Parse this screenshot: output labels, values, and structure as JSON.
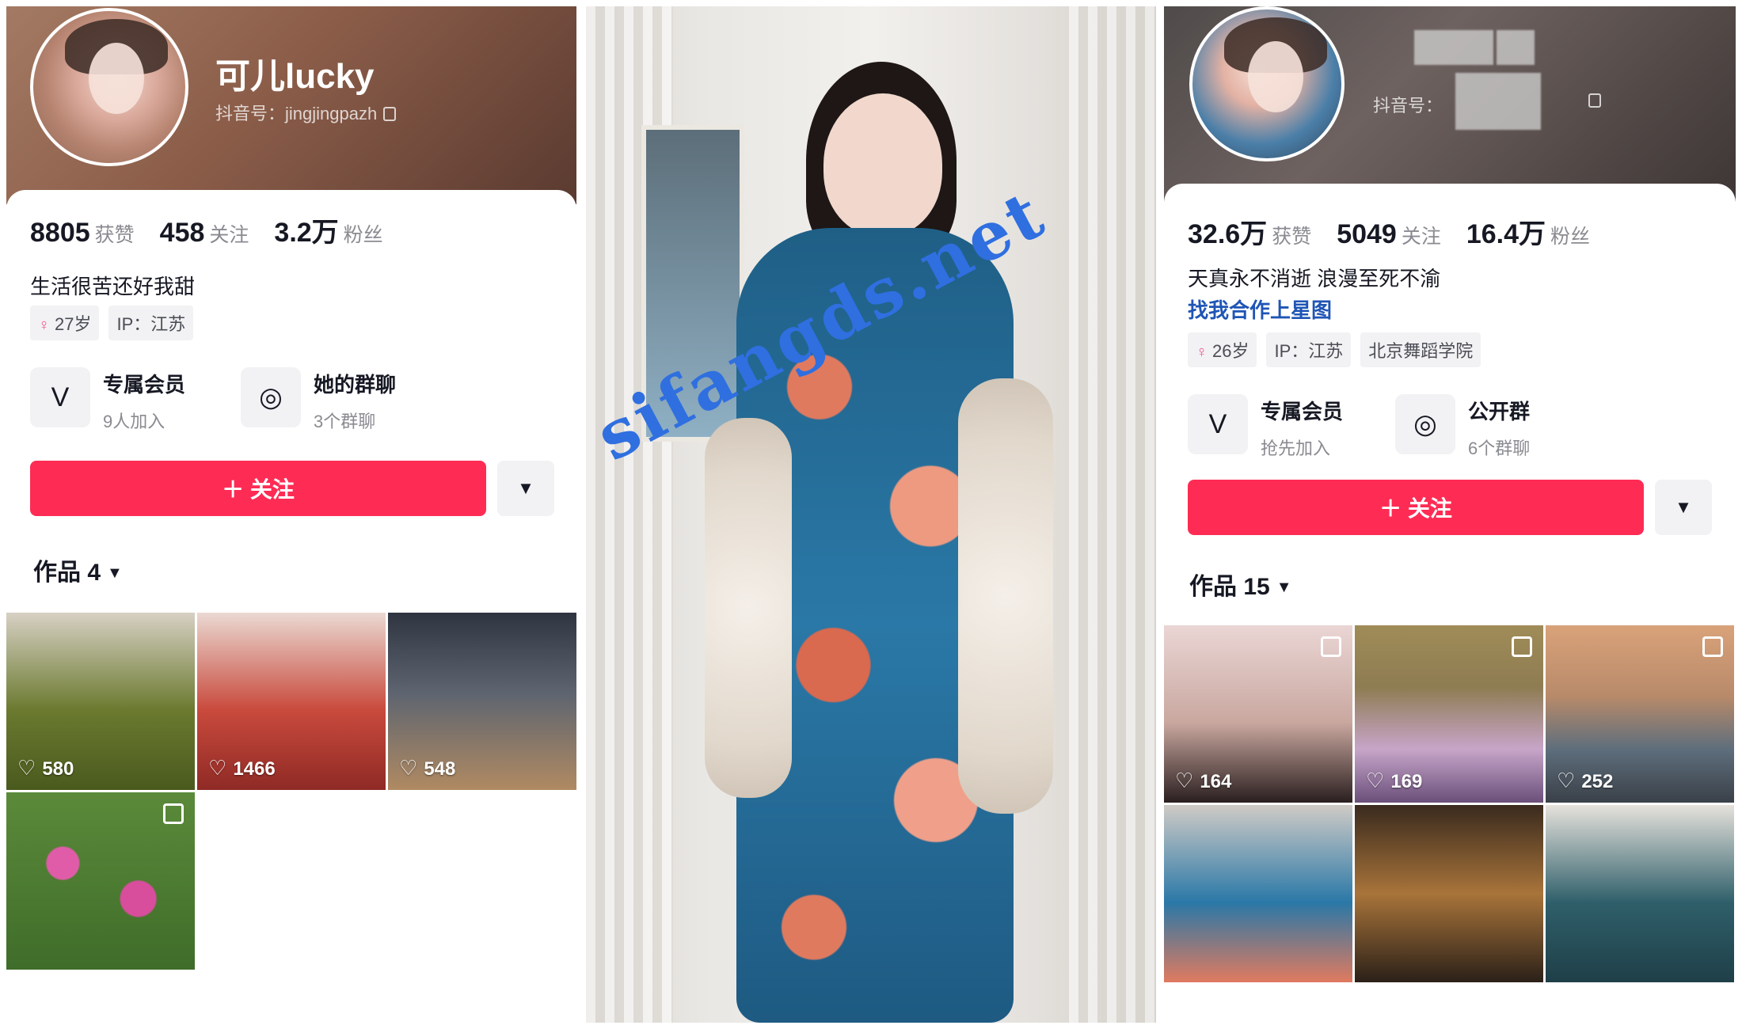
{
  "left": {
    "nickname": "可儿lucky",
    "douyin_id": "抖音号：jingjingpazh",
    "stats": [
      {
        "num": "8805",
        "label": "获赞"
      },
      {
        "num": "458",
        "label": "关注"
      },
      {
        "num": "3.2万",
        "label": "粉丝"
      }
    ],
    "bio": "生活很苦还好我甜",
    "tags": {
      "age": "27岁",
      "ip": "IP：江苏"
    },
    "features": [
      {
        "title": "专属会员",
        "sub": "9人加入"
      },
      {
        "title": "她的群聊",
        "sub": "3个群聊"
      }
    ],
    "follow_label": "＋ 关注",
    "works_label": "作品 4",
    "thumbs": [
      {
        "likes": "580"
      },
      {
        "likes": "1466"
      },
      {
        "likes": "548"
      },
      {
        "likes": ""
      }
    ]
  },
  "middle": {
    "watermark": "sifangds.net"
  },
  "right": {
    "douyin_id": "抖音号：",
    "stats": [
      {
        "num": "32.6万",
        "label": "获赞"
      },
      {
        "num": "5049",
        "label": "关注"
      },
      {
        "num": "16.4万",
        "label": "粉丝"
      }
    ],
    "bio": "天真永不消逝 浪漫至死不渝",
    "bio_link": "找我合作上星图",
    "tags": {
      "age": "26岁",
      "ip": "IP：江苏",
      "school": "北京舞蹈学院"
    },
    "features": [
      {
        "title": "专属会员",
        "sub": "抢先加入"
      },
      {
        "title": "公开群",
        "sub": "6个群聊"
      }
    ],
    "follow_label": "＋ 关注",
    "works_label": "作品 15",
    "thumbs": [
      {
        "likes": "164"
      },
      {
        "likes": "169"
      },
      {
        "likes": "252"
      },
      {
        "likes": ""
      },
      {
        "likes": ""
      },
      {
        "likes": ""
      }
    ]
  },
  "icons": {
    "member": "V",
    "chat": "◎",
    "heart": "♡",
    "caret": "▼",
    "gender": "♀"
  }
}
